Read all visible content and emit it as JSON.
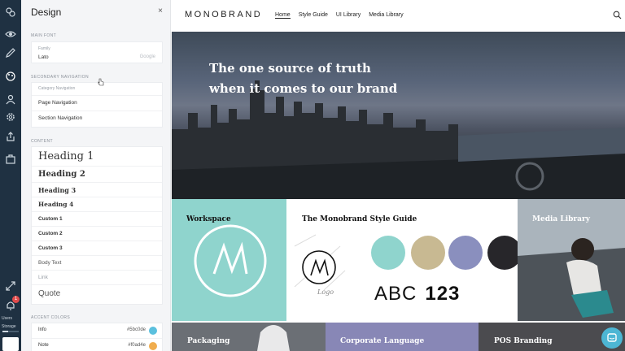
{
  "rail": {
    "badge_count": "1",
    "users_label": "Users",
    "storage_label": "Storage",
    "storage_fraction": 0.35
  },
  "panel": {
    "title": "Design",
    "close_glyph": "×",
    "main_font": {
      "section_label": "MAIN FONT",
      "field_label": "Family",
      "value": "Lato",
      "source": "Google"
    },
    "secondary_navigation": {
      "section_label": "SECONDARY NAVIGATION",
      "items": [
        "Category Navigation",
        "Page Navigation",
        "Section Navigation"
      ]
    },
    "content": {
      "section_label": "CONTENT",
      "items": [
        "Heading 1",
        "Heading 2",
        "Heading 3",
        "Heading 4",
        "Custom 1",
        "Custom 2",
        "Custom 3",
        "Body Text",
        "Link",
        "Quote"
      ]
    },
    "accent_colors": {
      "section_label": "ACCENT COLORS",
      "items": [
        {
          "name": "Info",
          "hex": "#5bc0de",
          "color": "#5bc0de"
        },
        {
          "name": "Note",
          "hex": "#f0ad4e",
          "color": "#f0ad4e"
        }
      ]
    }
  },
  "site": {
    "logo": "MONOBRAND",
    "nav": [
      "Home",
      "Style Guide",
      "UI Library",
      "Media Library"
    ],
    "hero": {
      "line1": "The one source of truth",
      "line2": "when it comes to our brand"
    },
    "tiles": {
      "workspace": "Workspace",
      "style_guide": "The Monobrand Style Guide",
      "logo_caption": "Logo",
      "abc": "ABC",
      "digits": "123",
      "swatches": [
        "#8fd4cd",
        "#c8b992",
        "#8a8fbe",
        "#27262a"
      ],
      "media": "Media Library",
      "packaging": "Packaging",
      "corporate": "Corporate Language",
      "pos": "POS Branding"
    }
  }
}
